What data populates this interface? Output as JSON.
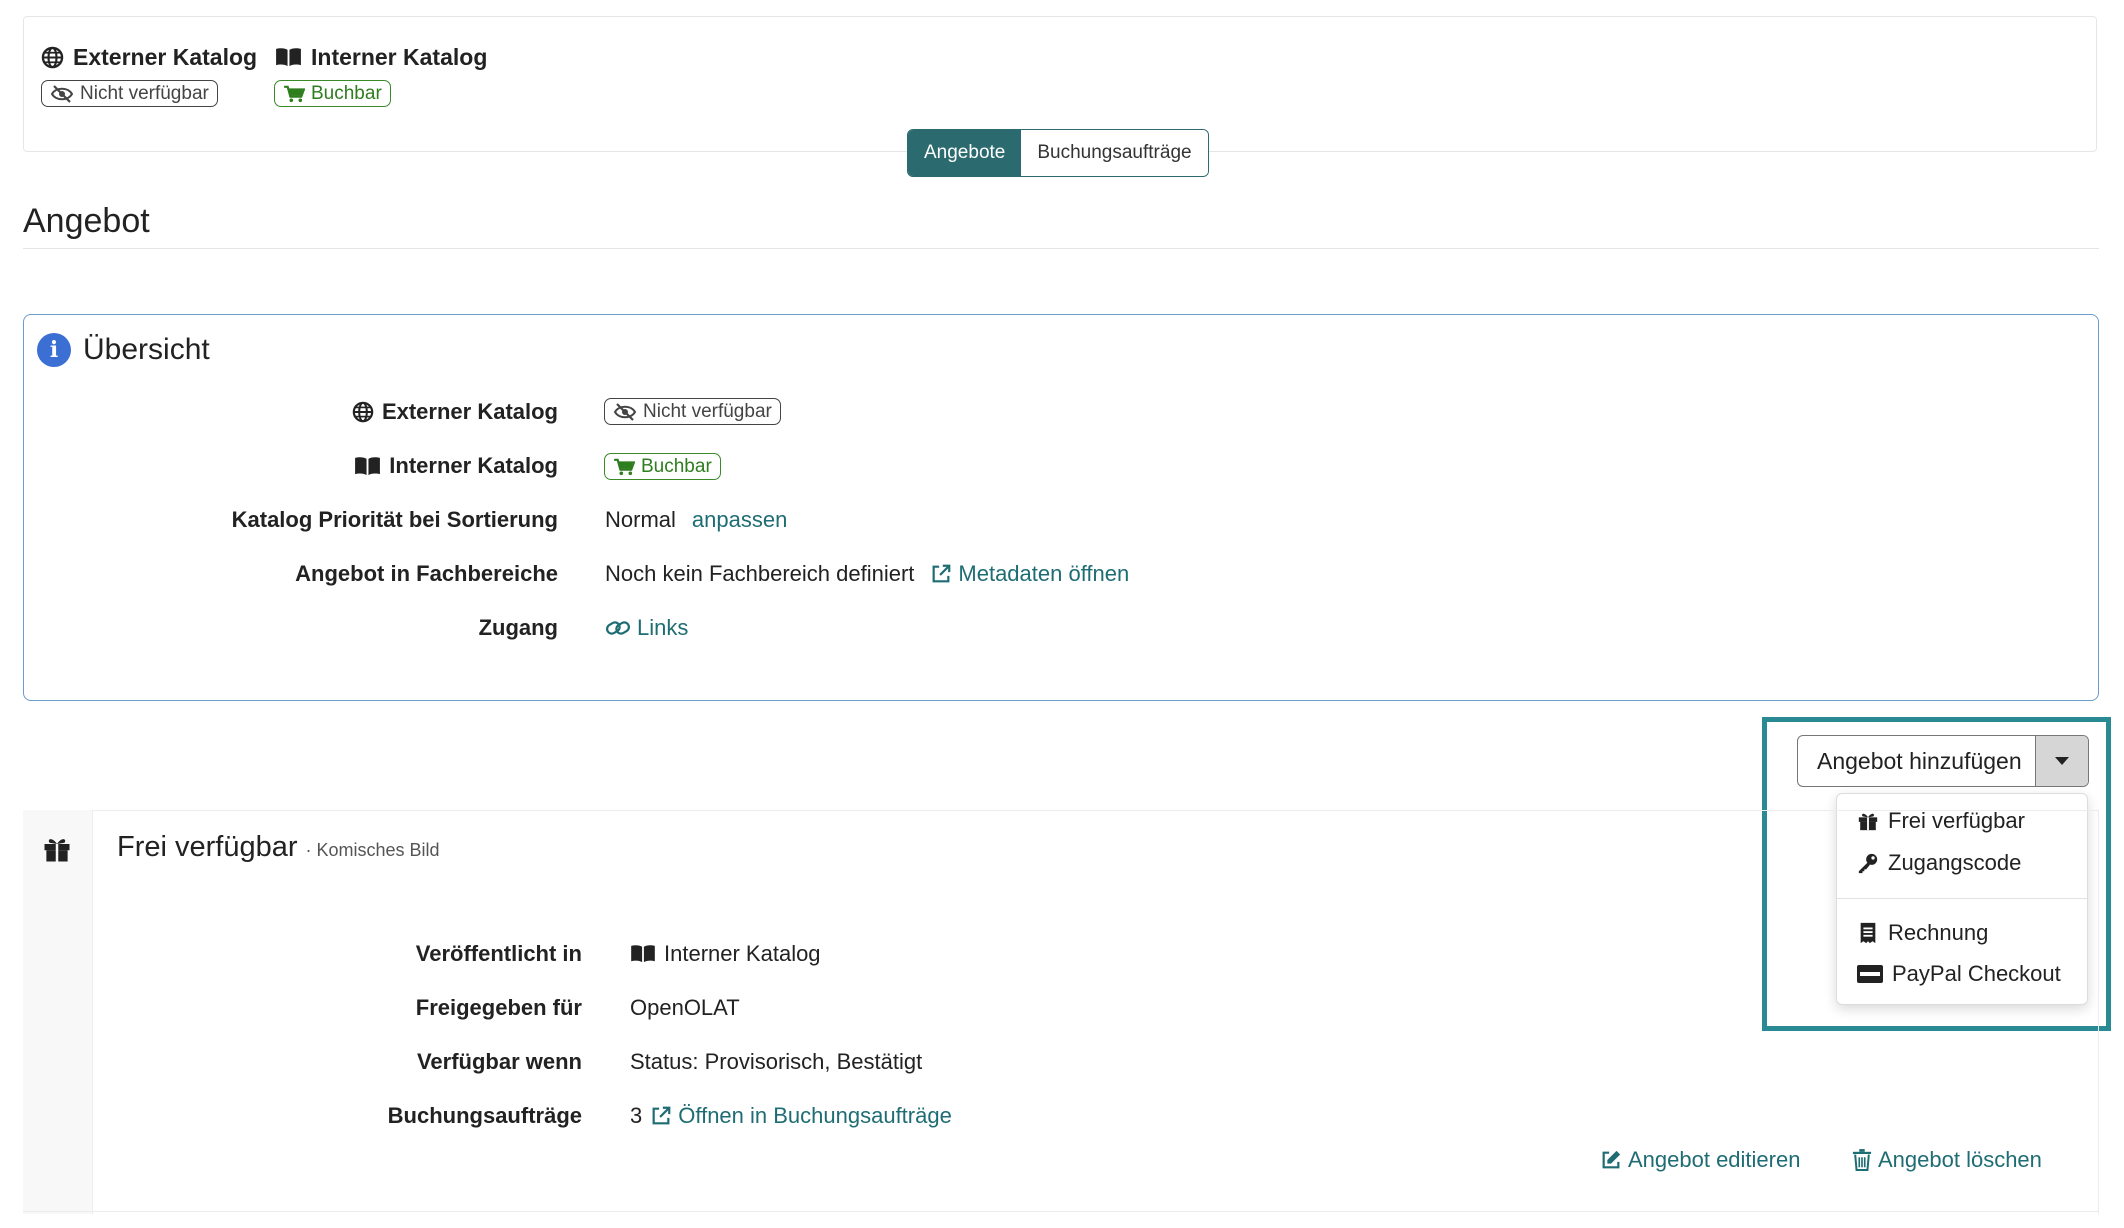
{
  "catalogs": {
    "external": {
      "title": "Externer Katalog",
      "status": "Nicht verfügbar",
      "icon": "globe-icon"
    },
    "internal": {
      "title": "Interner Katalog",
      "status": "Buchbar",
      "icon": "book-open-icon",
      "status_icon": "cart-icon"
    }
  },
  "tabs": {
    "offers": "Angebote",
    "bookings": "Buchungsaufträge"
  },
  "section": {
    "title": "Angebot"
  },
  "overview": {
    "title": "Übersicht",
    "rows": {
      "external_label": "Externer Katalog",
      "external_value": "Nicht verfügbar",
      "internal_label": "Interner Katalog",
      "internal_value": "Buchbar",
      "priority_label": "Katalog Priorität bei Sortierung",
      "priority_value": "Normal",
      "priority_link": "anpassen",
      "fields_label": "Angebot in Fachbereiche",
      "fields_value": "Noch kein Fachbereich definiert",
      "fields_link": "Metadaten öffnen",
      "access_label": "Zugang",
      "access_link": "Links"
    }
  },
  "add_offer": {
    "label": "Angebot hinzufügen",
    "menu": {
      "free": "Frei verfügbar",
      "code": "Zugangscode",
      "invoice": "Rechnung",
      "paypal": "PayPal Checkout"
    }
  },
  "offer": {
    "title": "Frei verfügbar",
    "subtitle": "· Komisches Bild",
    "published_label": "Veröffentlicht in",
    "published_value": "Interner Katalog",
    "released_label": "Freigegeben für",
    "released_value": "OpenOLAT",
    "available_label": "Verfügbar wenn",
    "available_value": "Status: Provisorisch, Bestätigt",
    "bookings_label": "Buchungsaufträge",
    "bookings_count": "3",
    "bookings_link": "Öffnen in Buchungsaufträge",
    "edit": "Angebot editieren",
    "delete": "Angebot löschen"
  },
  "colors": {
    "accent": "#2b6a6e",
    "link": "#1f6d74",
    "success": "#3a8a2a",
    "info": "#3b6fd3",
    "highlight": "#2a8a93"
  }
}
